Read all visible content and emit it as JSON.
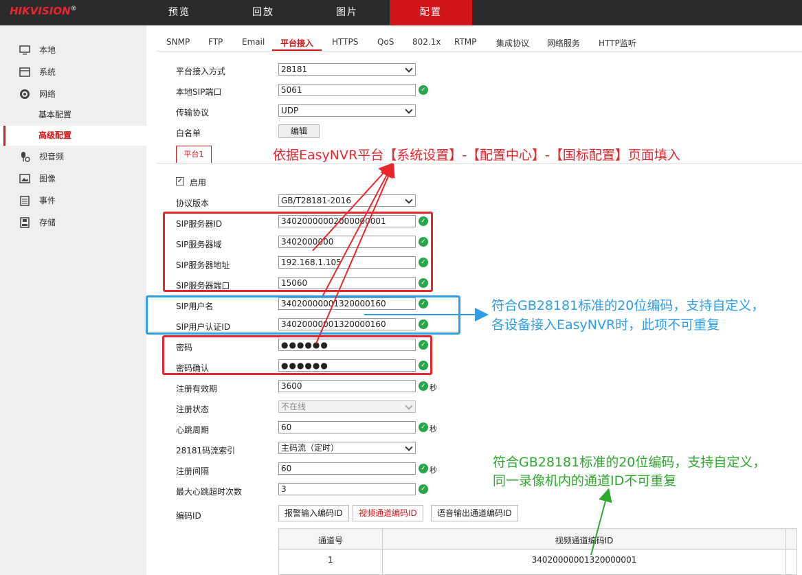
{
  "header": {
    "logo_brand": "HIKVISION",
    "logo_mark": "®",
    "nav": [
      "预览",
      "回放",
      "图片",
      "配置"
    ],
    "active_nav": "配置"
  },
  "sidebar": {
    "items": [
      {
        "label": "本地",
        "icon": "monitor-icon"
      },
      {
        "label": "系统",
        "icon": "system-icon"
      },
      {
        "label": "网络",
        "icon": "globe-icon"
      },
      {
        "label": "视音频",
        "icon": "audio-video-icon"
      },
      {
        "label": "图像",
        "icon": "image-icon"
      },
      {
        "label": "事件",
        "icon": "event-icon"
      },
      {
        "label": "存储",
        "icon": "storage-icon"
      }
    ],
    "sub_items": [
      "基本配置",
      "高级配置"
    ],
    "active_sub": "高级配置"
  },
  "tabs": [
    "SNMP",
    "FTP",
    "Email",
    "平台接入",
    "HTTPS",
    "QoS",
    "802.1x",
    "RTMP",
    "集成协议",
    "网络服务",
    "HTTP监听"
  ],
  "active_tab": "平台接入",
  "form": {
    "access_mode": {
      "label": "平台接入方式",
      "value": "28181"
    },
    "local_sip_port": {
      "label": "本地SIP端口",
      "value": "5061"
    },
    "transport": {
      "label": "传输协议",
      "value": "UDP"
    },
    "whitelist": {
      "label": "白名单",
      "button": "编辑"
    },
    "platform_tab": "平台1",
    "enable": {
      "label": "启用",
      "checked": true,
      "mark": "✓"
    },
    "protocol_version": {
      "label": "协议版本",
      "value": "GB/T28181-2016"
    },
    "sip_server_id": {
      "label": "SIP服务器ID",
      "value": "34020000002000000001"
    },
    "sip_server_domain": {
      "label": "SIP服务器域",
      "value": "3402000000"
    },
    "sip_server_address": {
      "label": "SIP服务器地址",
      "value": "192.168.1.105"
    },
    "sip_server_port": {
      "label": "SIP服务器端口",
      "value": "15060"
    },
    "sip_username": {
      "label": "SIP用户名",
      "value": "34020000001320000160"
    },
    "sip_auth_id": {
      "label": "SIP用户认证ID",
      "value": "34020000001320000160"
    },
    "password": {
      "label": "密码",
      "value": "●●●●●●"
    },
    "password_confirm": {
      "label": "密码确认",
      "value": "●●●●●●"
    },
    "register_validity": {
      "label": "注册有效期",
      "value": "3600",
      "unit": "秒"
    },
    "register_status": {
      "label": "注册状态",
      "value": "不在线"
    },
    "heartbeat_period": {
      "label": "心跳周期",
      "value": "60",
      "unit": "秒"
    },
    "stream_index": {
      "label": "28181码流索引",
      "value": "主码流（定时）"
    },
    "register_interval": {
      "label": "注册间隔",
      "value": "60",
      "unit": "秒"
    },
    "max_heartbeat_timeout": {
      "label": "最大心跳超时次数",
      "value": "3"
    },
    "code_id": {
      "label": "编码ID"
    },
    "ok_mark": "✓"
  },
  "code_tabs": [
    "报警输入编码ID",
    "视频通道编码ID",
    "语音输出通道编码ID"
  ],
  "active_code_tab": "视频通道编码ID",
  "table": {
    "headers": [
      "通道号",
      "视频通道编码ID"
    ],
    "rows": [
      [
        "1",
        "34020000001320000001"
      ]
    ]
  },
  "annotations": {
    "red": "依据EasyNVR平台【系统设置】-【配置中心】-【国标配置】页面填入",
    "blue_line1": "符合GB28181标准的20位编码，支持自定义，",
    "blue_line2": "各设备接入EasyNVR时，此项不可重复",
    "green_line1": "符合GB28181标准的20位编码，支持自定义，",
    "green_line2": "同一录像机内的通道ID不可重复"
  },
  "colors": {
    "accent": "#d1161b",
    "annotation_red": "#e8262d",
    "annotation_blue": "#2f9ee8",
    "annotation_green": "#2ea82e",
    "ok": "#2aa54a"
  }
}
